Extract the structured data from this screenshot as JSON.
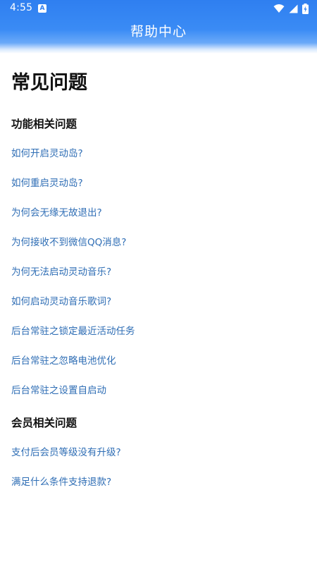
{
  "status_bar": {
    "time": "4:55",
    "notification_icon_letter": "A",
    "icons": [
      "wifi-icon",
      "cell-signal-icon",
      "battery-charging-icon"
    ]
  },
  "header": {
    "title": "帮助中心"
  },
  "main": {
    "page_title": "常见问题",
    "sections": [
      {
        "title": "功能相关问题",
        "items": [
          "如何开启灵动岛?",
          "如何重启灵动岛?",
          "为何会无缘无故退出?",
          "为何接收不到微信QQ消息?",
          "为何无法启动灵动音乐?",
          "如何启动灵动音乐歌词?",
          "后台常驻之锁定最近活动任务",
          "后台常驻之忽略电池优化",
          "后台常驻之设置自启动"
        ]
      },
      {
        "title": "会员相关问题",
        "items": [
          "支付后会员等级没有升级?",
          "满足什么条件支持退款?"
        ]
      }
    ]
  },
  "colors": {
    "header_blue": "#2f7ff0",
    "link_blue": "#2f6eb5",
    "text_dark": "#111111"
  }
}
